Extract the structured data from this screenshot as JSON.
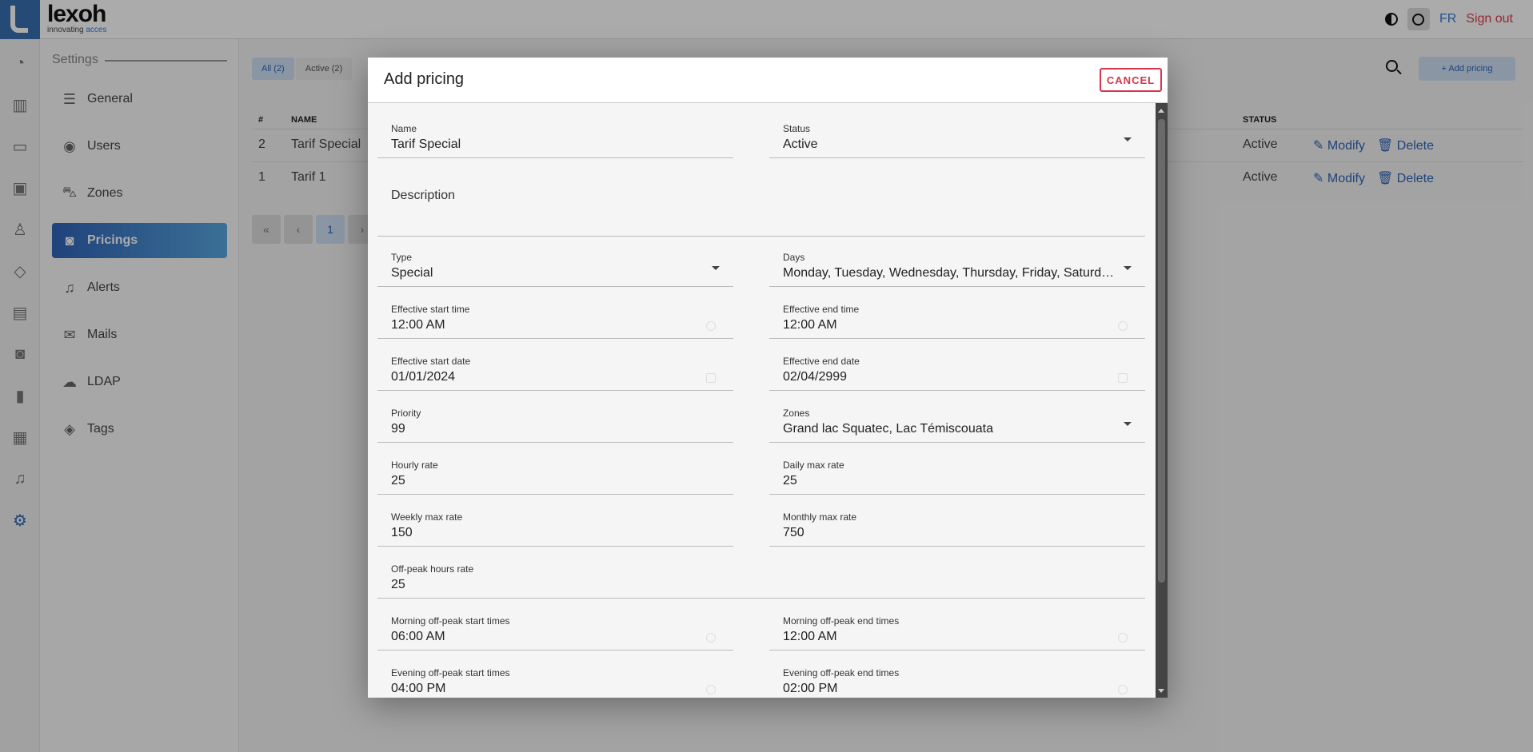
{
  "header": {
    "brand_name": "lexoh",
    "brand_tag_prefix": "innovating ",
    "brand_tag_accent": "acces",
    "lang": "FR",
    "signout": "Sign out"
  },
  "colors": {
    "accent": "#2f64b8",
    "danger": "#d9344a",
    "brand_tile": "#3a6fb0"
  },
  "rail_icons": [
    "dashboard-icon",
    "map-icon",
    "camera-icon",
    "chip-icon",
    "person-icon",
    "ticket-icon",
    "document-icon",
    "money-icon",
    "chart-icon",
    "calendar-icon",
    "bell-icon",
    "gear-icon"
  ],
  "settings": {
    "title": "Settings",
    "items": [
      {
        "label": "General",
        "icon": "list-icon"
      },
      {
        "label": "Users",
        "icon": "user-circle-icon"
      },
      {
        "label": "Zones",
        "icon": "car-icon"
      },
      {
        "label": "Pricings",
        "icon": "money-icon"
      },
      {
        "label": "Alerts",
        "icon": "bell-icon"
      },
      {
        "label": "Mails",
        "icon": "envelope-icon"
      },
      {
        "label": "LDAP",
        "icon": "cloud-icon"
      },
      {
        "label": "Tags",
        "icon": "tag-icon"
      }
    ],
    "active_index": 3
  },
  "main": {
    "tabs": [
      "All (2)",
      "Active (2)"
    ],
    "add_button": "+ Add pricing",
    "table": {
      "headers": {
        "num": "#",
        "name": "NAME",
        "status": "STATUS"
      },
      "rows": [
        {
          "num": "2",
          "name": "Tarif Special",
          "status": "Active",
          "modify": "Modify",
          "delete": "Delete"
        },
        {
          "num": "1",
          "name": "Tarif 1",
          "status": "Active",
          "modify": "Modify",
          "delete": "Delete"
        }
      ]
    },
    "pager": {
      "first": "«",
      "prev": "‹",
      "current": "1",
      "next": "›"
    }
  },
  "modal": {
    "title": "Add pricing",
    "cancel": "CANCEL",
    "fields": {
      "name": {
        "label": "Name",
        "value": "Tarif Special"
      },
      "status": {
        "label": "Status",
        "value": "Active"
      },
      "description": {
        "label": "Description",
        "value": ""
      },
      "type": {
        "label": "Type",
        "value": "Special"
      },
      "days": {
        "label": "Days",
        "value": "Monday, Tuesday, Wednesday, Thursday, Friday, Saturday..."
      },
      "eff_start_time": {
        "label": "Effective start time",
        "value": "12:00  AM"
      },
      "eff_end_time": {
        "label": "Effective end time",
        "value": "12:00  AM"
      },
      "eff_start_date": {
        "label": "Effective start date",
        "value": "01/01/2024"
      },
      "eff_end_date": {
        "label": "Effective end date",
        "value": "02/04/2999"
      },
      "priority": {
        "label": "Priority",
        "value": "99"
      },
      "zones": {
        "label": "Zones",
        "value": "Grand lac Squatec, Lac Témiscouata"
      },
      "hourly": {
        "label": "Hourly rate",
        "value": "25"
      },
      "daily_max": {
        "label": "Daily max rate",
        "value": "25"
      },
      "weekly_max": {
        "label": "Weekly max rate",
        "value": "150"
      },
      "monthly_max": {
        "label": "Monthly max rate",
        "value": "750"
      },
      "offpeak": {
        "label": "Off-peak hours rate",
        "value": "25"
      },
      "morning_start": {
        "label": "Morning off-peak start times",
        "value": "06:00  AM"
      },
      "morning_end": {
        "label": "Morning off-peak end times",
        "value": "12:00  AM"
      },
      "evening_start": {
        "label": "Evening off-peak start times",
        "value": "04:00  PM"
      },
      "evening_end": {
        "label": "Evening off-peak end times",
        "value": "02:00  PM"
      }
    }
  }
}
